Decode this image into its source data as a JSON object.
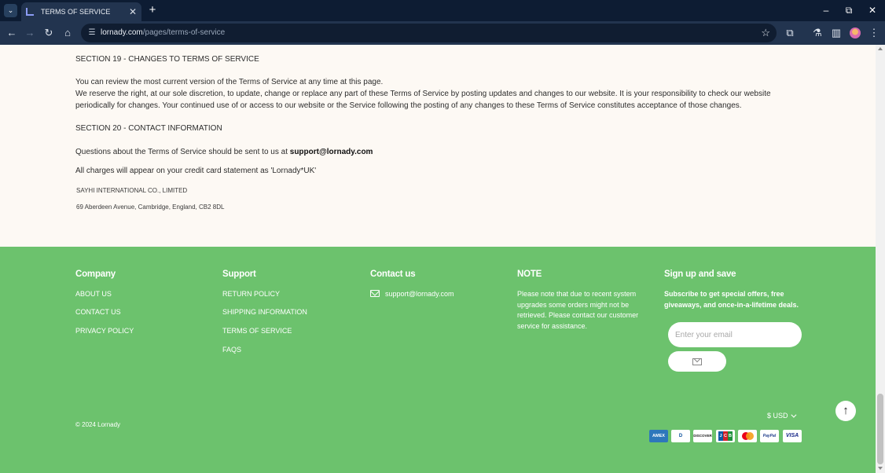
{
  "browser": {
    "tab_title": "TERMS OF SERVICE",
    "url_domain": "lornady.com",
    "url_path": "/pages/terms-of-service"
  },
  "content": {
    "section19_title": "SECTION 19 - CHANGES TO TERMS OF SERVICE",
    "section19_p1": "You can review the most current version of the Terms of Service at any time at this page.",
    "section19_p2": "We reserve the right, at our sole discretion, to update, change or replace any part of these Terms of Service by posting updates and changes to our website. It is your responsibility to check our website periodically for changes. Your continued use of or access to our website or the Service following the posting of any changes to these Terms of Service constitutes acceptance of those changes.",
    "section20_title": "SECTION 20 - CONTACT INFORMATION",
    "contact_text": "Questions about the Terms of Service should be sent to us at",
    "contact_email": "support@lornady.com",
    "charges_text": "All charges will appear on your credit card statement as 'Lornady*UK'",
    "company_name": "SAYHI INTERNATIONAL CO., LIMITED",
    "company_address": "69 Aberdeen Avenue, Cambridge, England, CB2 8DL"
  },
  "footer": {
    "company": {
      "heading": "Company",
      "links": [
        "ABOUT US",
        "CONTACT US",
        "PRIVACY POLICY"
      ]
    },
    "support": {
      "heading": "Support",
      "links": [
        "RETURN POLICY",
        "SHIPPING INFORMATION",
        "TERMS OF SERVICE",
        "FAQS"
      ]
    },
    "contact": {
      "heading": "Contact us",
      "email": "support@lornady.com"
    },
    "note": {
      "heading": "NOTE",
      "text": "Please note that due to recent system upgrades some orders might not be retrieved. Please contact our customer service for assistance."
    },
    "signup": {
      "heading": "Sign up and save",
      "text": "Subscribe to get special offers, free giveaways, and once-in-a-lifetime deals.",
      "placeholder": "Enter your email"
    },
    "currency": "$ USD",
    "copyright": "© 2024 Lornady",
    "payments": {
      "amex": "AMEX",
      "diners": "D",
      "discover": "DISCOVER",
      "jcb": [
        "J",
        "C",
        "B"
      ],
      "paypal": "PayPal",
      "visa": "VISA"
    }
  },
  "colors": {
    "footer_bg": "#6cc26d",
    "page_bg": "#fdf9f4",
    "browser_frame": "#0d1c33"
  }
}
